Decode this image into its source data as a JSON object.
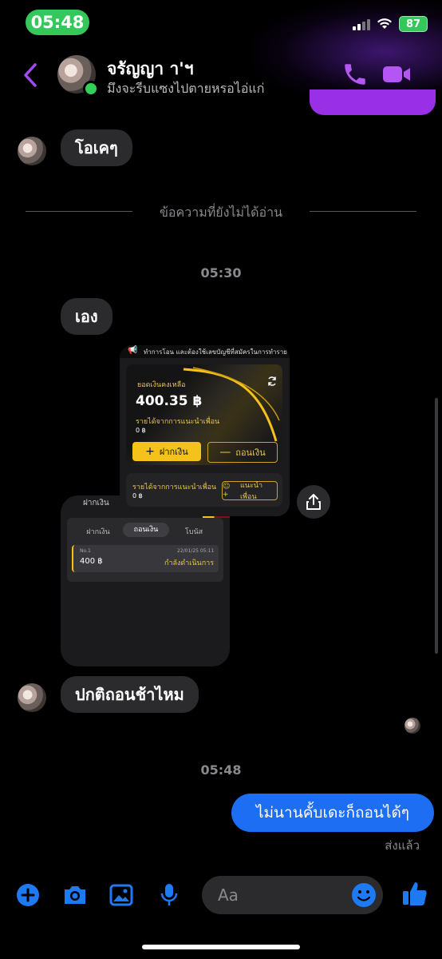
{
  "status_bar": {
    "time": "05:48",
    "battery": "87"
  },
  "header": {
    "contact_name": "จรัญญา า'ฯ",
    "subtitle": "มึงจะรีบแซงไปตายหรอไอ่แก่"
  },
  "messages": {
    "msg_ok": "โอเคๆ",
    "unread_divider": "ข้อความที่ยังไม่ได้อ่าน",
    "time_1": "05:30",
    "msg_eng": "เอง",
    "msg_question": "ปกติถอนช้าไหม",
    "time_2": "05:48",
    "msg_reply": "ไม่นานคั้บเดะก็ถอนได้ๆ",
    "sent_status": "ส่งแล้ว"
  },
  "screenshot_card": {
    "banner": "ทำการโอน และต้องใช้เลขบัญชีที่สมัครในการทำรายก",
    "balance_label": "ยอดเงินคงเหลือ",
    "balance": "400.35 ฿",
    "referral_income_label": "รายได้จากการแนะนำเพื่อน",
    "referral_income": "0 ฿",
    "deposit_button": "ฝากเงิน",
    "withdraw_button": "ถอนเงิน",
    "referral_label": "รายได้จากการแนะนำเพื่อน",
    "referral_value": "0 ฿",
    "invite_button": "แนะนำเพื่อน"
  },
  "history_card": {
    "title": "ฝากเงิน",
    "tabs": [
      "ฝากเงิน",
      "ถอนเงิน",
      "โบนัส"
    ],
    "entry_no": "No.1",
    "entry_date": "22/01/25 05:11",
    "entry_amount": "400 ฿",
    "entry_status": "กำลังดำเนินการ"
  },
  "composer": {
    "placeholder": "Aa"
  },
  "colors": {
    "accent_purple": "#9a2fe8",
    "messenger_blue": "#1d6ef2",
    "gold": "#f4c21a",
    "bubble_gray": "#2b2b2e"
  }
}
